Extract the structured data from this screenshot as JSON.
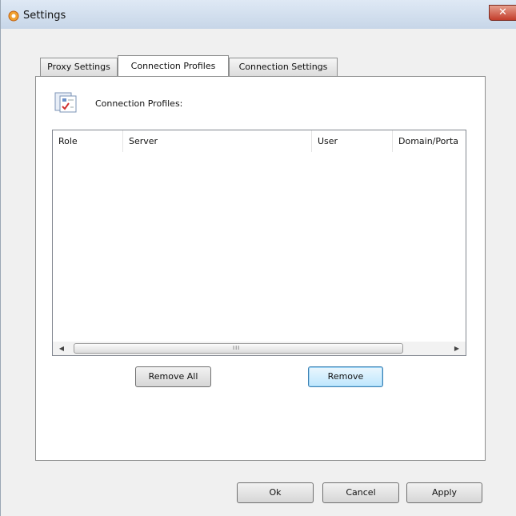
{
  "window": {
    "title": "Settings",
    "close_glyph": "✕"
  },
  "tabs": [
    {
      "label": "Proxy Settings",
      "active": false
    },
    {
      "label": "Connection Profiles",
      "active": true
    },
    {
      "label": "Connection Settings",
      "active": false
    }
  ],
  "profiles": {
    "label": "Connection Profiles:",
    "icon": "connection-profiles-icon",
    "columns": [
      "Role",
      "Server",
      "User",
      "Domain/Porta"
    ],
    "rows": [],
    "scroll": {
      "left_glyph": "◀",
      "right_glyph": "▶",
      "grip": "III"
    }
  },
  "list_buttons": {
    "remove_all": "Remove All",
    "remove": "Remove"
  },
  "dialog_buttons": {
    "ok": "Ok",
    "cancel": "Cancel",
    "apply": "Apply"
  },
  "colors": {
    "titlebar": "#c7d6e8",
    "close": "#c33d2b",
    "focus": "#3c7fb1"
  }
}
